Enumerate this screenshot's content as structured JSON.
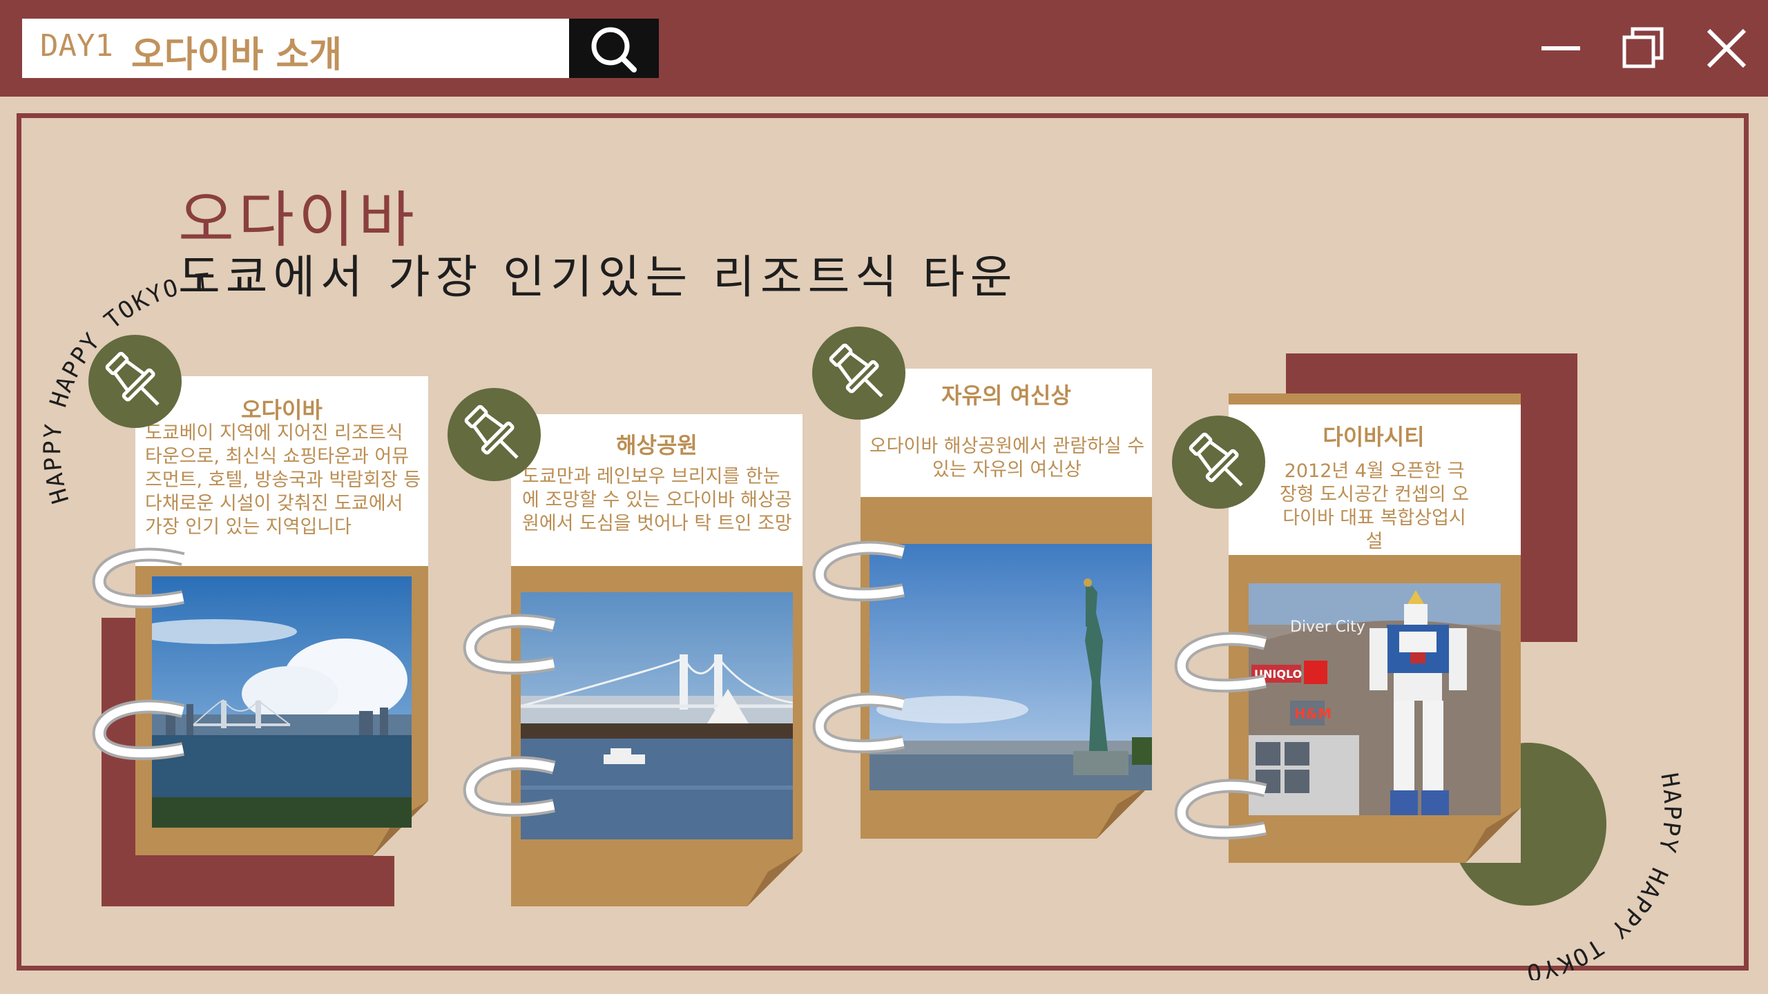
{
  "search": {
    "day": "DAY1",
    "title": "오다이바 소개"
  },
  "heading": {
    "main": "오다이바",
    "sub": "도쿄에서 가장 인기있는 리조트식 타운"
  },
  "curved_text": {
    "left": "HAPPY HAPPY TOKYO TOUR",
    "right": "HAPPY HAPPY TOKYO TOUR"
  },
  "cards": [
    {
      "title": "오다이바",
      "description": "도쿄베이 지역에 지어진 리조트식 타운으로, 최신식 쇼핑타운과 어뮤즈먼트, 호텔, 방송국과 박람회장 등 다채로운 시설이 갖춰진 도쿄에서 가장 인기 있는 지역입니다"
    },
    {
      "title": "해상공원",
      "description": "도쿄만과 레인보우 브리지를 한눈에 조망할 수 있는 오다이바 해상공원에서 도심을 벗어나 탁 트인 조망"
    },
    {
      "title": "자유의 여신상",
      "description": "오다이바 해상공원에서 관람하실 수 있는 자유의 여신상"
    },
    {
      "title": "다이바시티",
      "description": "2012년 4월 오픈한 극장형 도시공간 컨셉의 오다이바 대표 복합상업시설"
    }
  ],
  "photo_signs": {
    "diver_city": "Diver City",
    "uniqlo": "UNIQLO",
    "hm": "H&M"
  },
  "colors": {
    "maroon": "#8a3f3f",
    "olive": "#636b3f",
    "tan": "#bb8e53",
    "background": "#e1cdb8"
  },
  "icons": [
    "search-icon",
    "minimize-icon",
    "restore-icon",
    "close-icon",
    "pushpin-icon",
    "binder-ring"
  ]
}
